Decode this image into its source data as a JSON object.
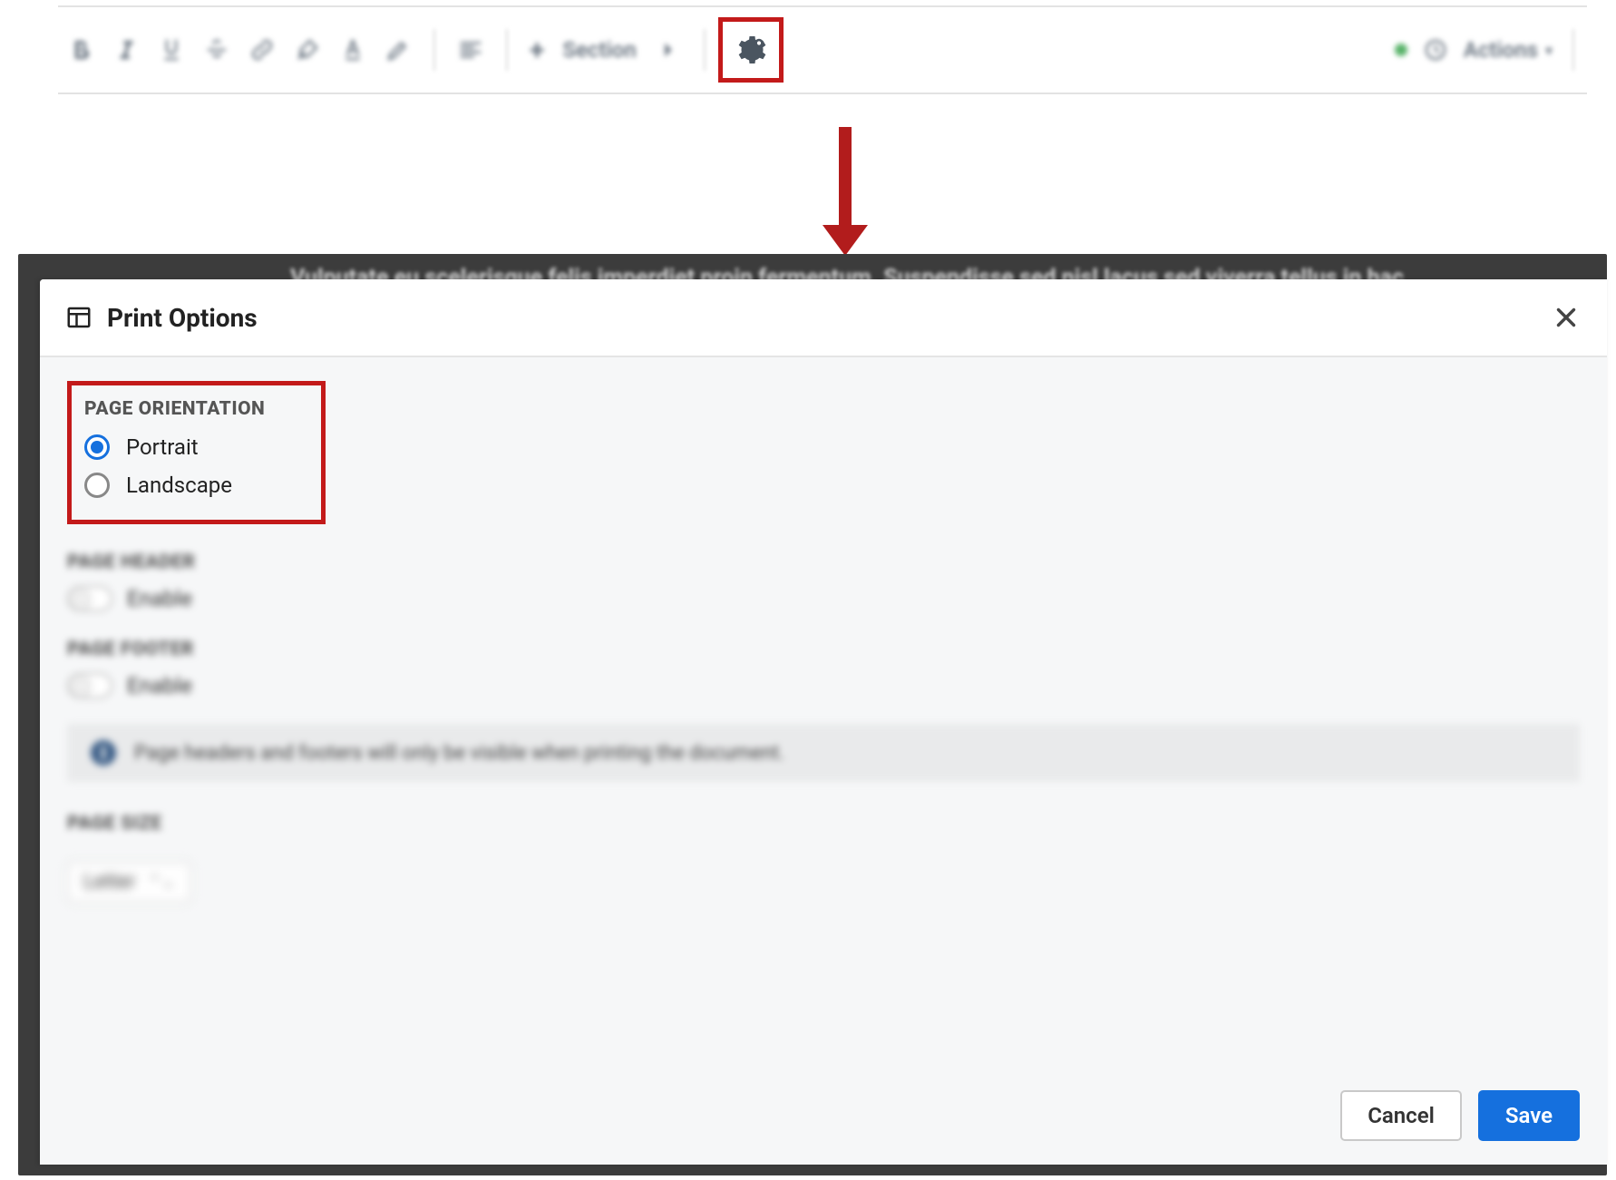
{
  "toolbar": {
    "section_label": "Section",
    "actions_label": "Actions"
  },
  "arrow": {},
  "peek_text": "Vulputate eu scelerisque felis imperdiet proin fermentum. Suspendisse sed nisl lacus sed viverra tellus in hac",
  "modal": {
    "title": "Print Options",
    "orientation": {
      "label": "PAGE ORIENTATION",
      "options": [
        {
          "label": "Portrait",
          "checked": true
        },
        {
          "label": "Landscape",
          "checked": false
        }
      ]
    },
    "header_section": {
      "label": "PAGE HEADER",
      "toggle_label": "Enable",
      "enabled": false
    },
    "footer_section": {
      "label": "PAGE FOOTER",
      "toggle_label": "Enable",
      "enabled": false
    },
    "info_note": "Page headers and footers will only be visible when printing the document.",
    "size_section": {
      "label": "PAGE SIZE",
      "value": "Letter"
    },
    "buttons": {
      "cancel": "Cancel",
      "save": "Save"
    }
  }
}
